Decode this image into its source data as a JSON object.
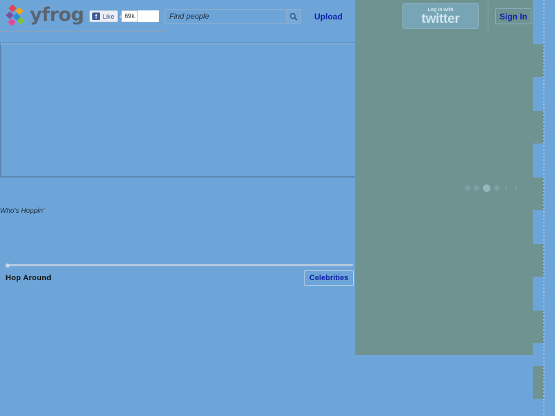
{
  "header": {
    "logo_text": "yfrog",
    "facebook": {
      "like_label": "Like",
      "like_count": "69k"
    },
    "search": {
      "placeholder": "Find people"
    },
    "upload_label": "Upload",
    "twitter_login": {
      "small_text": "Log in with",
      "brand_text": "twitter"
    },
    "signin_label": "Sign In"
  },
  "main": {
    "section_label": "Who's Hoppin'",
    "hop_around_label": "Hop Around",
    "category_button_label": "Celebrities",
    "carousel": {
      "dot_count": 4,
      "active_dot": 2
    }
  },
  "colors": {
    "background": "#6ea5d8",
    "overlay": "#6f9391",
    "link": "#0b1fa8",
    "logo_text": "#5b6470"
  },
  "icons": {
    "logo": "yfrog-diamond-logo",
    "search": "search-icon",
    "carousel_prev": "chevron-left-icon",
    "carousel_next": "chevron-right-icon"
  }
}
